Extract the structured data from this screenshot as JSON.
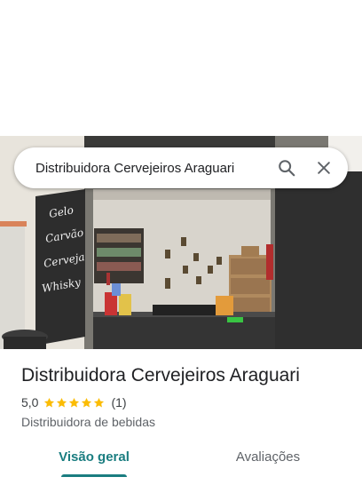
{
  "search": {
    "value": "Distribuidora Cervejeiros Araguari",
    "search_icon": "search-icon",
    "close_icon": "close-icon"
  },
  "photo": {
    "sign_words": [
      "Gelo",
      "Carvão",
      "Cerveja",
      "Whisky"
    ]
  },
  "place": {
    "name": "Distribuidora Cervejeiros Araguari",
    "rating": "5,0",
    "stars": 5,
    "review_count": "(1)",
    "category": "Distribuidora de bebidas"
  },
  "tabs": [
    {
      "label": "Visão geral",
      "active": true
    },
    {
      "label": "Avaliações",
      "active": false
    }
  ],
  "colors": {
    "accent": "#1a7d80",
    "star": "#fbbc04",
    "title_text": "#202124",
    "secondary_text": "#5f6368"
  }
}
